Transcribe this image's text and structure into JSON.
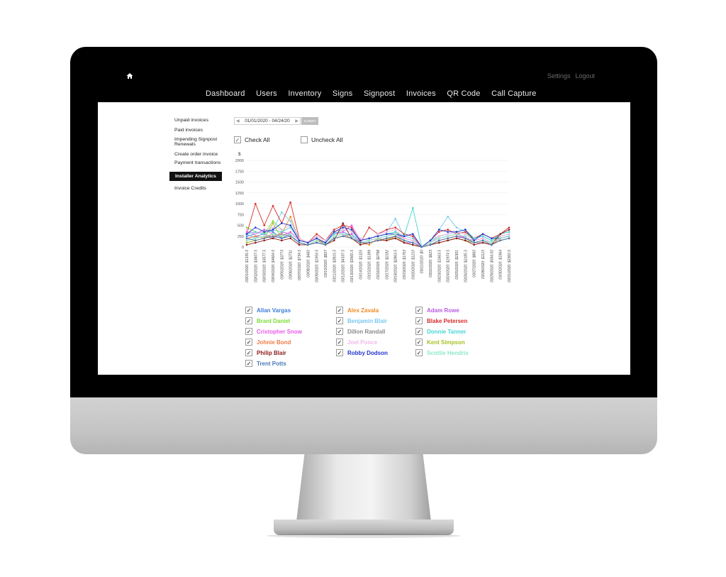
{
  "colors": {
    "bezel": "#000000",
    "screen": "#ffffff",
    "nav_text": "#e9e9e9",
    "active_bg": "#111111"
  },
  "topbar": {
    "home_icon": "home-icon",
    "settings": "Settings",
    "logout": "Logout"
  },
  "nav": [
    "Dashboard",
    "Users",
    "Inventory",
    "Signs",
    "Signpost",
    "Invoices",
    "QR Code",
    "Call Capture"
  ],
  "sidebar": {
    "items": [
      "Unpaid invoices",
      "Paid invoices",
      "Impending Signpost",
      "Renewals",
      "Create order invoice",
      "Payment transactions",
      "Installer Analytics",
      "Invoice Credits"
    ],
    "active": "Installer Analytics"
  },
  "filters": {
    "date_range": "01/01/2020 - 04/24/20",
    "submit": "SUBMIT",
    "check_all": "Check All",
    "uncheck_all": "Uncheck All"
  },
  "chart_data": {
    "type": "line",
    "ylabel": "$",
    "ylim": [
      0,
      2000
    ],
    "yticks": [
      "0",
      "250",
      "500",
      "750",
      "1000",
      "1250",
      "1500",
      "1750",
      "2000"
    ],
    "categories": [
      "03/01/2020: $1335.5",
      "03/02/2020: $3607.5",
      "03/03/2020: $3577.5",
      "03/04/2020: $4664.5",
      "03/05/2020: $3773",
      "03/06/2020: $2731",
      "03/07/2020: $734.5",
      "03/08/2020: $460",
      "03/09/2020: $1954.5",
      "03/10/2020: $827",
      "03/11/2020: $3915.5",
      "03/12/2020: $4337.5",
      "03/13/2020: $3565.5",
      "03/14/2020: $1325",
      "03/15/2020: $1399",
      "03/16/2020: $2798",
      "03/17/2020: $2182",
      "03/18/2020: $2863.5",
      "03/19/2020: $1763",
      "03/20/2020: $1210",
      "03/21/2020: $0",
      "03/22/2020: $623",
      "03/23/2020: $1663.5",
      "03/24/2020: $1974.5",
      "03/25/2020: $2301",
      "03/26/2020: $2185.5",
      "03/27/2020: $860",
      "03/28/2020: $1115",
      "03/29/2020: $594.00",
      "03/30/2020: $1964",
      "03/31/2020: $2360.5"
    ],
    "series": [
      {
        "name": "Allan Vargas",
        "color": "#3d7dd8",
        "values": [
          250,
          300,
          400,
          350,
          200,
          300,
          100,
          50,
          150,
          100,
          300,
          350,
          250,
          100,
          150,
          200,
          250,
          300,
          150,
          100,
          0,
          100,
          250,
          300,
          350,
          300,
          150,
          200,
          100,
          250,
          300
        ]
      },
      {
        "name": "Alex Zavala",
        "color": "#f08a24",
        "values": [
          100,
          150,
          200,
          250,
          300,
          700,
          150,
          100,
          200,
          50,
          250,
          300,
          200,
          100,
          50,
          200,
          150,
          250,
          100,
          50,
          0,
          50,
          150,
          200,
          250,
          200,
          100,
          150,
          50,
          200,
          250
        ]
      },
      {
        "name": "Adam Rowe",
        "color": "#b85be0",
        "values": [
          200,
          250,
          300,
          200,
          350,
          300,
          100,
          50,
          100,
          50,
          200,
          250,
          300,
          100,
          100,
          150,
          200,
          200,
          100,
          100,
          0,
          50,
          100,
          150,
          200,
          250,
          100,
          100,
          50,
          150,
          200
        ]
      },
      {
        "name": "Brant Daniel",
        "color": "#7bdc3a",
        "values": [
          450,
          350,
          300,
          600,
          400,
          500,
          150,
          100,
          200,
          100,
          350,
          450,
          400,
          150,
          200,
          250,
          300,
          350,
          200,
          150,
          0,
          100,
          200,
          250,
          300,
          350,
          150,
          200,
          100,
          300,
          350
        ]
      },
      {
        "name": "Benjamin Blair",
        "color": "#78c8f0",
        "values": [
          300,
          200,
          350,
          400,
          800,
          600,
          200,
          100,
          250,
          150,
          350,
          300,
          250,
          200,
          150,
          300,
          350,
          650,
          250,
          200,
          0,
          150,
          400,
          700,
          450,
          350,
          200,
          250,
          150,
          300,
          400
        ]
      },
      {
        "name": "Blake Petersen",
        "color": "#d62b2b",
        "values": [
          300,
          1000,
          500,
          950,
          550,
          1030,
          200,
          100,
          300,
          150,
          400,
          500,
          450,
          100,
          450,
          300,
          400,
          450,
          300,
          250,
          0,
          150,
          350,
          400,
          300,
          350,
          200,
          300,
          200,
          300,
          450
        ]
      },
      {
        "name": "Cristopher Snow",
        "color": "#e85ce8",
        "values": [
          350,
          300,
          400,
          300,
          250,
          350,
          150,
          100,
          200,
          100,
          300,
          350,
          500,
          150,
          200,
          250,
          300,
          300,
          200,
          150,
          0,
          100,
          200,
          250,
          300,
          200,
          150,
          200,
          100,
          200,
          250
        ]
      },
      {
        "name": "Dillon Randall",
        "color": "#8a8a8a",
        "values": [
          150,
          200,
          250,
          200,
          300,
          250,
          100,
          50,
          150,
          50,
          200,
          250,
          200,
          100,
          100,
          150,
          200,
          200,
          100,
          50,
          0,
          50,
          100,
          150,
          200,
          150,
          100,
          100,
          50,
          150,
          200
        ]
      },
      {
        "name": "Donnie Tanner",
        "color": "#45d6d6",
        "values": [
          300,
          350,
          300,
          400,
          350,
          450,
          150,
          100,
          200,
          100,
          300,
          400,
          350,
          150,
          200,
          250,
          300,
          350,
          250,
          900,
          0,
          150,
          250,
          300,
          350,
          400,
          200,
          250,
          150,
          300,
          350
        ]
      },
      {
        "name": "Johnie Bond",
        "color": "#f07a4a",
        "values": [
          200,
          250,
          200,
          300,
          250,
          300,
          100,
          50,
          150,
          50,
          200,
          250,
          200,
          100,
          100,
          150,
          200,
          250,
          150,
          100,
          0,
          50,
          150,
          200,
          250,
          200,
          100,
          150,
          50,
          200,
          250
        ]
      },
      {
        "name": "Joel Ponce",
        "color": "#f0b8e8",
        "values": [
          400,
          300,
          350,
          450,
          400,
          500,
          200,
          100,
          250,
          150,
          350,
          400,
          350,
          200,
          150,
          300,
          350,
          400,
          200,
          150,
          0,
          100,
          250,
          300,
          350,
          300,
          150,
          200,
          100,
          250,
          300
        ]
      },
      {
        "name": "Kent Simpson",
        "color": "#a8c02a",
        "values": [
          100,
          150,
          200,
          550,
          200,
          250,
          100,
          50,
          150,
          50,
          200,
          250,
          200,
          100,
          100,
          150,
          200,
          200,
          100,
          50,
          0,
          50,
          100,
          150,
          200,
          150,
          100,
          150,
          50,
          150,
          200
        ]
      },
      {
        "name": "Philip Blair",
        "color": "#8b1a1a",
        "values": [
          50,
          100,
          150,
          200,
          150,
          200,
          50,
          50,
          100,
          50,
          150,
          550,
          200,
          50,
          100,
          150,
          150,
          200,
          100,
          50,
          0,
          50,
          100,
          150,
          200,
          150,
          50,
          100,
          50,
          300,
          400
        ]
      },
      {
        "name": "Robby Dodson",
        "color": "#2233cc",
        "values": [
          300,
          450,
          350,
          400,
          550,
          500,
          150,
          100,
          200,
          100,
          350,
          450,
          400,
          150,
          200,
          250,
          300,
          300,
          250,
          300,
          0,
          150,
          400,
          350,
          350,
          400,
          150,
          300,
          200,
          200,
          250
        ]
      },
      {
        "name": "Scottie Hendrix",
        "color": "#8de8c8",
        "values": [
          150,
          200,
          250,
          300,
          250,
          300,
          100,
          50,
          150,
          50,
          250,
          300,
          250,
          100,
          150,
          200,
          250,
          300,
          150,
          100,
          0,
          100,
          200,
          250,
          300,
          250,
          100,
          150,
          100,
          200,
          250
        ]
      },
      {
        "name": "Trent Potts",
        "color": "#4a7ab5",
        "values": [
          200,
          150,
          200,
          250,
          200,
          250,
          100,
          50,
          100,
          50,
          200,
          250,
          200,
          100,
          100,
          150,
          200,
          250,
          150,
          100,
          0,
          50,
          150,
          200,
          250,
          200,
          100,
          150,
          50,
          150,
          200
        ]
      }
    ]
  },
  "legend": [
    {
      "name": "Allan Vargas",
      "color": "#3d7dd8"
    },
    {
      "name": "Alex Zavala",
      "color": "#f08a24"
    },
    {
      "name": "Adam Rowe",
      "color": "#b85be0"
    },
    {
      "name": "Brant Daniel",
      "color": "#7bdc3a"
    },
    {
      "name": "Benjamin Blair",
      "color": "#78c8f0"
    },
    {
      "name": "Blake Petersen",
      "color": "#d62b2b"
    },
    {
      "name": "Cristopher Snow",
      "color": "#e85ce8"
    },
    {
      "name": "Dillon Randall",
      "color": "#8a8a8a"
    },
    {
      "name": "Donnie Tanner",
      "color": "#45d6d6"
    },
    {
      "name": "Johnie Bond",
      "color": "#f07a4a"
    },
    {
      "name": "Joel Ponce",
      "color": "#f0b8e8"
    },
    {
      "name": "Kent Simpson",
      "color": "#a8c02a"
    },
    {
      "name": "Philip Blair",
      "color": "#8b1a1a"
    },
    {
      "name": "Robby Dodson",
      "color": "#2233cc"
    },
    {
      "name": "Scottie Hendrix",
      "color": "#8de8c8"
    },
    {
      "name": "Trent Potts",
      "color": "#4a7ab5"
    }
  ]
}
